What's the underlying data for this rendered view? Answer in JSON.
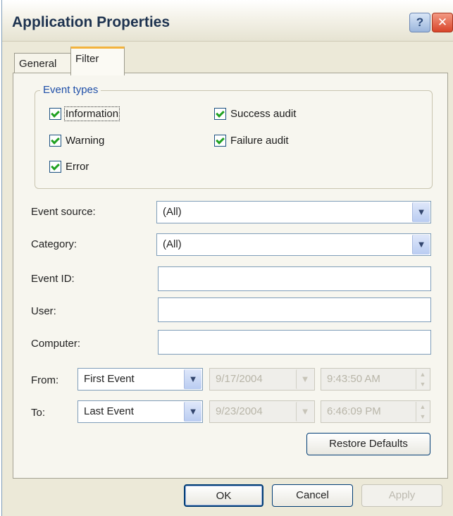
{
  "window": {
    "title": "Application Properties"
  },
  "titlebar": {
    "help_glyph": "?",
    "close_glyph": "✕"
  },
  "tabs": [
    {
      "label": "General"
    },
    {
      "label": "Filter"
    }
  ],
  "event_types": {
    "title": "Event types",
    "information": "Information",
    "warning": "Warning",
    "error": "Error",
    "success_audit": "Success audit",
    "failure_audit": "Failure audit"
  },
  "fields": {
    "event_source": {
      "label": "Event source:",
      "value": "(All)"
    },
    "category": {
      "label": "Category:",
      "value": "(All)"
    },
    "event_id": {
      "label": "Event ID:",
      "value": ""
    },
    "user": {
      "label": "User:",
      "value": ""
    },
    "computer": {
      "label": "Computer:",
      "value": ""
    }
  },
  "range": {
    "from": {
      "label": "From:",
      "mode": "First Event",
      "date": "9/17/2004",
      "time": "9:43:50 AM"
    },
    "to": {
      "label": "To:",
      "mode": "Last Event",
      "date": "9/23/2004",
      "time": "6:46:09 PM"
    }
  },
  "buttons": {
    "restore_defaults": "Restore Defaults",
    "ok": "OK",
    "cancel": "Cancel",
    "apply": "Apply"
  },
  "icons": {
    "dropdown": "▼",
    "spin_up": "▲",
    "spin_down": "▼"
  },
  "colors": {
    "accent_tab": "#f3b33d",
    "group_title": "#1f4fa8",
    "check": "#21a121",
    "close": "#d8452a"
  }
}
